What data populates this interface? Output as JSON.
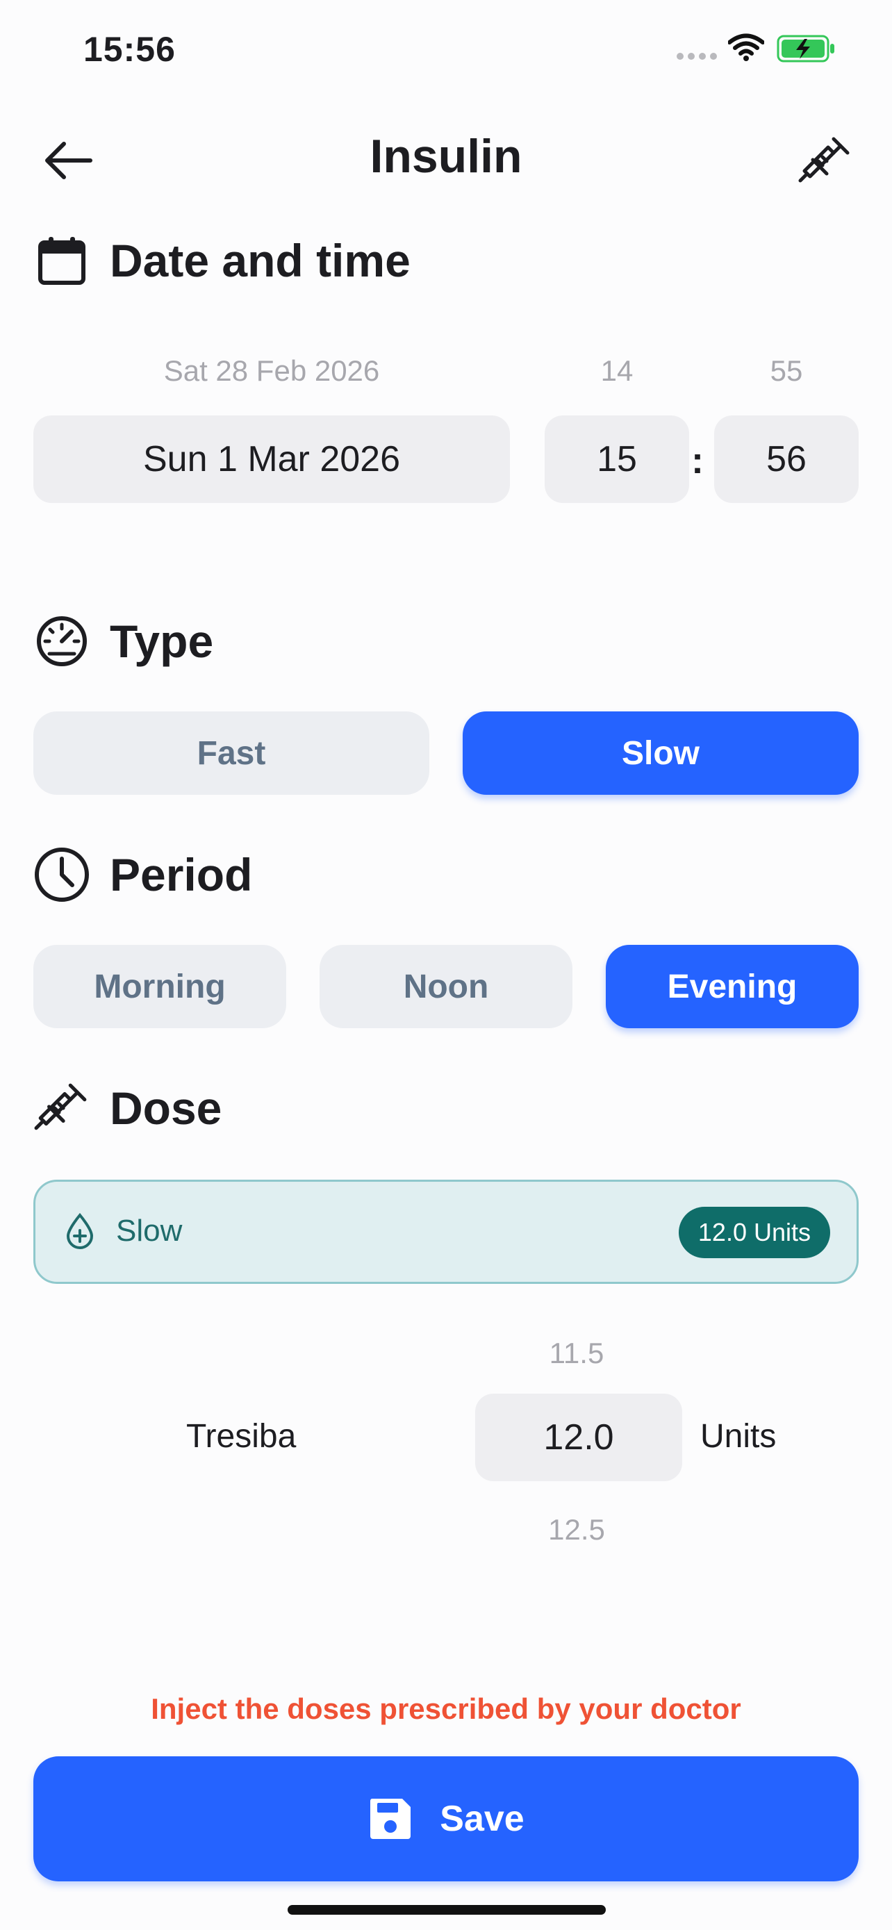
{
  "status_bar": {
    "time": "15:56"
  },
  "header": {
    "title": "Insulin"
  },
  "date_time": {
    "heading": "Date and time",
    "date_prev": "Sat 28 Feb 2026",
    "date_selected": "Sun 1 Mar 2026",
    "hour_prev": "14",
    "hour_selected": "15",
    "minute_prev": "55",
    "minute_selected": "56",
    "separator": ":"
  },
  "type": {
    "heading": "Type",
    "options": [
      {
        "label": "Fast",
        "selected": false
      },
      {
        "label": "Slow",
        "selected": true
      }
    ]
  },
  "period": {
    "heading": "Period",
    "options": [
      {
        "label": "Morning",
        "selected": false
      },
      {
        "label": "Noon",
        "selected": false
      },
      {
        "label": "Evening",
        "selected": true
      }
    ]
  },
  "dose": {
    "heading": "Dose",
    "card_label": "Slow",
    "card_badge": "12.0 Units",
    "brand": "Tresiba",
    "value_prev": "11.5",
    "value_selected": "12.0",
    "value_next": "12.5",
    "unit": "Units"
  },
  "note": "Inject the doses prescribed by your doctor",
  "save_label": "Save",
  "colors": {
    "accent": "#2563ff",
    "teal": "#0f6d69",
    "warning": "#ef5235"
  }
}
